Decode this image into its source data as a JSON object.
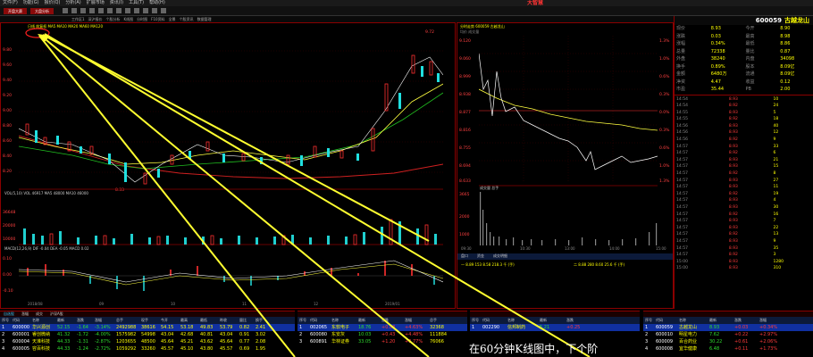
{
  "menu": {
    "items": [
      "文件(F)",
      "功能(G)",
      "报价(Q)",
      "分析(A)",
      "扩展市场",
      "资讯(I)",
      "工具(T)",
      "帮助(H)"
    ],
    "logo": "大智慧"
  },
  "toolbar": {
    "btn_a": "开盘大赛",
    "btn_b": "大盘分析"
  },
  "tabs": [
    "工作区1",
    "深沪报价",
    "个股分析",
    "K线图",
    "分时图",
    "F10资料",
    "全景",
    "个股资讯",
    "数据管理"
  ],
  "kline": {
    "header": "日线 前复权 MA5 MA10 MA20 MA60 MA120",
    "price_ticks": [
      "9.80",
      "9.60",
      "9.40",
      "9.20",
      "9.00",
      "8.80",
      "8.60",
      "8.40",
      "8.20"
    ],
    "high_label": "9.72",
    "low_label": "8.33",
    "vol_header": "VOL(5,10) VOL 46917 MA5 48000 MA10 46000",
    "vol_ticks": [
      "36648",
      "20000",
      "10000"
    ],
    "macd_header": "MACD(12,26,9) DIF -0.04 DEA -0.05 MACD 0.02",
    "macd_ticks": [
      "0.10",
      "0.00",
      "-0.10"
    ],
    "date_axis": [
      "2018/08",
      "09",
      "10",
      "11",
      "12",
      "2019/01"
    ]
  },
  "intraday": {
    "header": "分时走势 600059 古越龙山",
    "sub_header": "均价 成交量",
    "price_ticks_left": [
      "9.120",
      "9.060",
      "8.999",
      "8.938",
      "8.877",
      "8.816",
      "8.755",
      "8.694",
      "8.633"
    ],
    "pct_ticks_right": [
      "1.3%",
      "1.0%",
      "0.6%",
      "0.3%",
      "0.0%",
      "0.3%",
      "0.6%",
      "1.0%",
      "1.3%"
    ],
    "vol_header": "成交量 总手",
    "vol_ticks": [
      "3665",
      "2000",
      "1000"
    ],
    "time_axis": [
      "09:30",
      "10:30",
      "13:00",
      "14:00",
      "15:00"
    ],
    "bottom_tabs": [
      "盘口",
      "资金",
      "成交明细"
    ],
    "bottom_row1": "一 8.89  153  8.58  218.3 千 (手)",
    "bottom_row2": "二 8.88  280  8.60  25.6 千 (手)"
  },
  "sidebar": {
    "code": "600059",
    "name": "古越龙山",
    "quote_rows": [
      [
        "现价",
        "8.93",
        "今开",
        "8.90"
      ],
      [
        "涨跌",
        "0.03",
        "最高",
        "8.98"
      ],
      [
        "涨幅",
        "0.34%",
        "最低",
        "8.86"
      ],
      [
        "总量",
        "72338",
        "量比",
        "0.87"
      ],
      [
        "外盘",
        "38240",
        "内盘",
        "34098"
      ],
      [
        "换手",
        "0.89%",
        "股本",
        "8.09亿"
      ],
      [
        "金额",
        "6480万",
        "流通",
        "8.09亿"
      ],
      [
        "净资",
        "4.47",
        "收益",
        "0.12"
      ],
      [
        "市盈",
        "35.44",
        "PB",
        "2.00"
      ]
    ],
    "trades": [
      [
        "14:54",
        "8.93",
        "10"
      ],
      [
        "14:54",
        "8.92",
        "24"
      ],
      [
        "14:55",
        "8.93",
        "5"
      ],
      [
        "14:55",
        "8.92",
        "18"
      ],
      [
        "14:56",
        "8.93",
        "40"
      ],
      [
        "14:56",
        "8.93",
        "12"
      ],
      [
        "14:56",
        "8.92",
        "9"
      ],
      [
        "14:57",
        "8.93",
        "33"
      ],
      [
        "14:57",
        "8.92",
        "6"
      ],
      [
        "14:57",
        "8.93",
        "21"
      ],
      [
        "14:57",
        "8.93",
        "15"
      ],
      [
        "14:57",
        "8.92",
        "8"
      ],
      [
        "14:57",
        "8.93",
        "27"
      ],
      [
        "14:57",
        "8.93",
        "11"
      ],
      [
        "14:57",
        "8.92",
        "19"
      ],
      [
        "14:57",
        "8.93",
        "4"
      ],
      [
        "14:57",
        "8.93",
        "30"
      ],
      [
        "14:57",
        "8.92",
        "16"
      ],
      [
        "14:57",
        "8.93",
        "7"
      ],
      [
        "14:57",
        "8.93",
        "22"
      ],
      [
        "14:57",
        "8.92",
        "13"
      ],
      [
        "14:57",
        "8.93",
        "9"
      ],
      [
        "14:57",
        "8.93",
        "35"
      ],
      [
        "14:57",
        "8.92",
        "3"
      ],
      [
        "15:00",
        "8.93",
        "1280"
      ],
      [
        "15:00",
        "8.93",
        "310"
      ]
    ]
  },
  "bottom_left": {
    "tabs": [
      "自选股",
      "涨幅",
      "成交",
      "沪深A股"
    ],
    "headers": [
      "序号",
      "代码",
      "名称",
      "最新",
      "涨跌",
      "涨幅",
      "总手",
      "现手",
      "今开",
      "最高",
      "最低",
      "昨收",
      "量比",
      "换手"
    ],
    "rows": [
      [
        "1",
        "600000",
        "华兴源创",
        "52.15",
        "-1.64",
        "-3.14%",
        "2492988",
        "38616",
        "54.15",
        "53.18",
        "49.83",
        "53.79",
        "0.82",
        "2.41"
      ],
      [
        "2",
        "600001",
        "睿创微纳",
        "41.32",
        "-1.72",
        "-4.00%",
        "1575982",
        "54998",
        "43.04",
        "42.68",
        "40.81",
        "43.04",
        "0.91",
        "3.02"
      ],
      [
        "3",
        "600004",
        "天准科技",
        "44.33",
        "-1.31",
        "-2.87%",
        "1203655",
        "48500",
        "45.64",
        "45.21",
        "43.62",
        "45.64",
        "0.77",
        "2.08"
      ],
      [
        "4",
        "600005",
        "容百科技",
        "44.33",
        "-1.24",
        "-2.72%",
        "1059292",
        "33260",
        "45.57",
        "45.10",
        "43.80",
        "45.57",
        "0.69",
        "1.95"
      ]
    ]
  },
  "bottom_mid": {
    "headers": [
      "序号",
      "代码",
      "名称",
      "最新",
      "涨跌",
      "涨幅",
      "总手"
    ],
    "rows": [
      [
        "1",
        "002065",
        "东软电子",
        "18.76",
        "+0.83",
        "+4.63%",
        "32368"
      ],
      [
        "2",
        "600080",
        "东安灰",
        "10.03",
        "+0.43",
        "+4.48%",
        "111884"
      ],
      [
        "3",
        "600891",
        "华林证券",
        "33.05",
        "+1.20",
        "+3.77%",
        "76066"
      ]
    ]
  },
  "bottom_right1": {
    "headers": [
      "序号",
      "代码",
      "名称",
      "最新",
      "涨跌"
    ],
    "rows": [
      [
        "1",
        "002290",
        "信邦制药",
        "5.21",
        "+0.25"
      ]
    ]
  },
  "bottom_right2": {
    "headers": [
      "序号",
      "代码",
      "名称",
      "最新",
      "涨跌",
      "涨幅"
    ],
    "rows": [
      [
        "1",
        "600059",
        "古越龙山",
        "8.93",
        "+0.03",
        "+0.34%"
      ],
      [
        "2",
        "600010",
        "明星电力",
        "7.62",
        "+0.22",
        "+2.97%"
      ],
      [
        "3",
        "600009",
        "百合药业",
        "30.22",
        "+0.61",
        "+2.06%"
      ],
      [
        "4",
        "600008",
        "宜华健康",
        "6.48",
        "+0.11",
        "+1.73%"
      ]
    ]
  },
  "overlay_caption": "在60分钟K线图中，下个阶"
}
